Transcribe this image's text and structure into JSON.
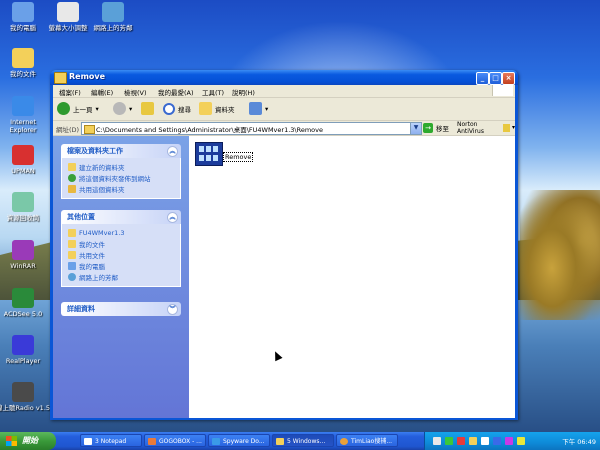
{
  "desktop": {
    "icons": [
      {
        "label": "我的電腦",
        "color": "#6aa0e8"
      },
      {
        "label": "螢幕大小調整",
        "color": "#e8e8e8"
      },
      {
        "label": "網路上的芳鄰",
        "color": "#5aa0d8"
      },
      {
        "label": "我的文件",
        "color": "#f3d05a"
      },
      {
        "label": "Internet Explorer",
        "color": "#3a8ae8"
      },
      {
        "label": "UPMAN",
        "color": "#d83030"
      },
      {
        "label": "資源回收筒",
        "color": "#7ac8a8"
      },
      {
        "label": "WinRAR",
        "color": "#9a3ab8"
      },
      {
        "label": "ACDSee 5.0",
        "color": "#2a8a3a"
      },
      {
        "label": "RealPlayer",
        "color": "#3a3ad8"
      },
      {
        "label": "線上聽Radio v1.5",
        "color": "#4a4a4a"
      }
    ]
  },
  "window": {
    "title": "Remove",
    "menu": [
      "檔案(F)",
      "編輯(E)",
      "檢視(V)",
      "我的最愛(A)",
      "工具(T)",
      "說明(H)"
    ],
    "toolbar": {
      "back": "上一頁",
      "search": "搜尋",
      "folders": "資料夾"
    },
    "address": {
      "label": "網址(D)",
      "value": "C:\\Documents and Settings\\Administrator\\桌面\\FU4WMver1.3\\Remove",
      "go": "移至"
    },
    "norton": "Norton AntiVirus",
    "tasks_panel": {
      "title": "檔案及資料夾工作",
      "items": [
        "建立新的資料夾",
        "將這個資料夾發佈到網站",
        "共用這個資料夾"
      ]
    },
    "places_panel": {
      "title": "其他位置",
      "items": [
        "FU4WMver1.3",
        "我的文件",
        "共用文件",
        "我的電腦",
        "網路上的芳鄰"
      ]
    },
    "details_panel": {
      "title": "詳細資料"
    },
    "file": {
      "name": "Remove"
    }
  },
  "taskbar": {
    "start": "開始",
    "tasks": [
      "3 Notepad",
      "GOGOBOX - ...",
      "Spyware Do...",
      "5 Windows...",
      "TimLiao搜捕..."
    ],
    "clock": "下午 06:49"
  }
}
